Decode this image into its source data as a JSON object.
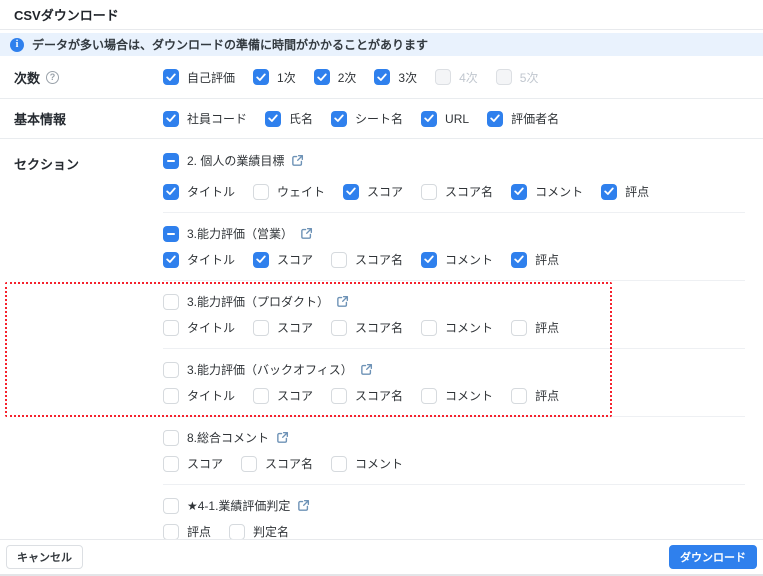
{
  "dialog": {
    "title": "CSVダウンロード"
  },
  "banner": {
    "icon": "info-circle-icon",
    "text": "データが多い場合は、ダウンロードの準備に時間がかかることがあります"
  },
  "colors": {
    "accent_blue": "#2f80ed",
    "banner_bg": "#e9f2fd",
    "highlight_red": "#f5222d"
  },
  "icons": {
    "help": "question-circle",
    "section_link": "external-link",
    "info": "info-circle"
  },
  "rows": [
    {
      "label": "次数",
      "has_help_icon": true,
      "options": [
        {
          "label": "自己評価",
          "state": "checked"
        },
        {
          "label": "1次",
          "state": "checked"
        },
        {
          "label": "2次",
          "state": "checked"
        },
        {
          "label": "3次",
          "state": "checked"
        },
        {
          "label": "4次",
          "state": "disabled"
        },
        {
          "label": "5次",
          "state": "disabled"
        }
      ]
    },
    {
      "label": "基本情報",
      "has_help_icon": false,
      "options": [
        {
          "label": "社員コード",
          "state": "checked"
        },
        {
          "label": "氏名",
          "state": "checked"
        },
        {
          "label": "シート名",
          "state": "checked"
        },
        {
          "label": "URL",
          "state": "checked"
        },
        {
          "label": "評価者名",
          "state": "checked"
        }
      ]
    }
  ],
  "section_area": {
    "label": "セクション",
    "highlighted_section_indexes": [
      0,
      1
    ],
    "sections": [
      {
        "title": "2. 個人の業績目標",
        "state": "indeterminate",
        "options": [
          {
            "label": "タイトル",
            "state": "checked"
          },
          {
            "label": "ウェイト",
            "state": "unchecked"
          },
          {
            "label": "スコア",
            "state": "checked"
          },
          {
            "label": "スコア名",
            "state": "unchecked"
          },
          {
            "label": "コメント",
            "state": "checked"
          },
          {
            "label": "評点",
            "state": "checked"
          }
        ]
      },
      {
        "title": "3.能力評価（営業）",
        "state": "indeterminate",
        "options": [
          {
            "label": "タイトル",
            "state": "checked"
          },
          {
            "label": "スコア",
            "state": "checked"
          },
          {
            "label": "スコア名",
            "state": "unchecked"
          },
          {
            "label": "コメント",
            "state": "checked"
          },
          {
            "label": "評点",
            "state": "checked"
          }
        ]
      },
      {
        "title": "3.能力評価（プロダクト）",
        "state": "unchecked",
        "options": [
          {
            "label": "タイトル",
            "state": "unchecked"
          },
          {
            "label": "スコア",
            "state": "unchecked"
          },
          {
            "label": "スコア名",
            "state": "unchecked"
          },
          {
            "label": "コメント",
            "state": "unchecked"
          },
          {
            "label": "評点",
            "state": "unchecked"
          }
        ]
      },
      {
        "title": "3.能力評価（バックオフィス）",
        "state": "unchecked",
        "options": [
          {
            "label": "タイトル",
            "state": "unchecked"
          },
          {
            "label": "スコア",
            "state": "unchecked"
          },
          {
            "label": "スコア名",
            "state": "unchecked"
          },
          {
            "label": "コメント",
            "state": "unchecked"
          },
          {
            "label": "評点",
            "state": "unchecked"
          }
        ]
      },
      {
        "title": "8.総合コメント",
        "state": "unchecked",
        "options": [
          {
            "label": "スコア",
            "state": "unchecked"
          },
          {
            "label": "スコア名",
            "state": "unchecked"
          },
          {
            "label": "コメント",
            "state": "unchecked"
          }
        ]
      },
      {
        "title": "★4-1.業績評価判定",
        "state": "unchecked",
        "options": [
          {
            "label": "評点",
            "state": "unchecked"
          },
          {
            "label": "判定名",
            "state": "unchecked"
          }
        ]
      }
    ]
  },
  "footer": {
    "cancel_label": "キャンセル",
    "download_label": "ダウンロード"
  }
}
